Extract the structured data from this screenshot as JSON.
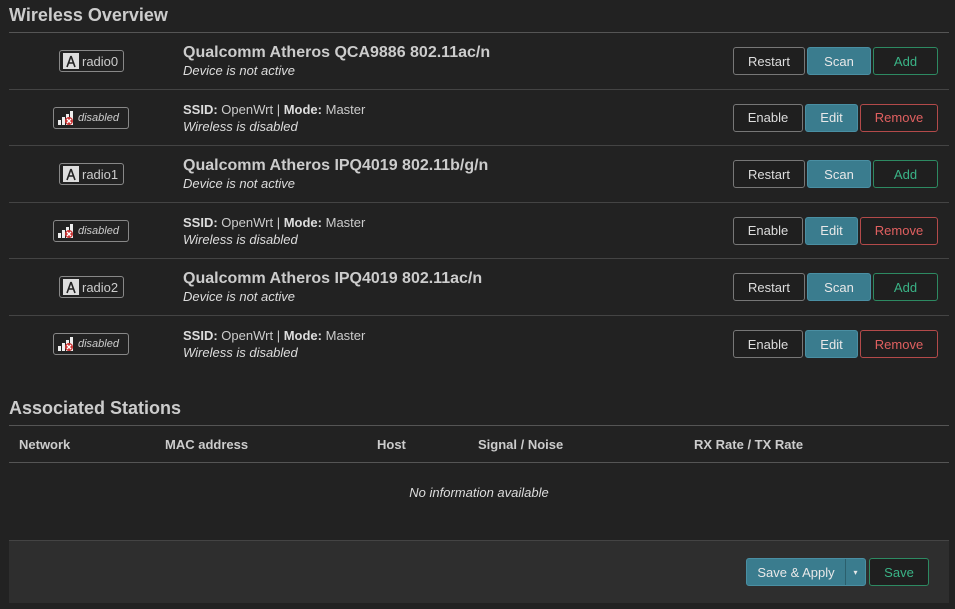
{
  "wireless": {
    "title": "Wireless Overview",
    "devices": [
      {
        "radio": {
          "badge": "radio0",
          "title": "Qualcomm Atheros QCA9886 802.11ac/n",
          "status": "Device is not active",
          "restart": "Restart",
          "scan": "Scan",
          "add": "Add"
        },
        "net": {
          "badge": "disabled",
          "ssid_label": "SSID:",
          "ssid": "OpenWrt",
          "sep": "|",
          "mode_label": "Mode:",
          "mode": "Master",
          "status": "Wireless is disabled",
          "enable": "Enable",
          "edit": "Edit",
          "remove": "Remove"
        }
      },
      {
        "radio": {
          "badge": "radio1",
          "title": "Qualcomm Atheros IPQ4019 802.11b/g/n",
          "status": "Device is not active",
          "restart": "Restart",
          "scan": "Scan",
          "add": "Add"
        },
        "net": {
          "badge": "disabled",
          "ssid_label": "SSID:",
          "ssid": "OpenWrt",
          "sep": "|",
          "mode_label": "Mode:",
          "mode": "Master",
          "status": "Wireless is disabled",
          "enable": "Enable",
          "edit": "Edit",
          "remove": "Remove"
        }
      },
      {
        "radio": {
          "badge": "radio2",
          "title": "Qualcomm Atheros IPQ4019 802.11ac/n",
          "status": "Device is not active",
          "restart": "Restart",
          "scan": "Scan",
          "add": "Add"
        },
        "net": {
          "badge": "disabled",
          "ssid_label": "SSID:",
          "ssid": "OpenWrt",
          "sep": "|",
          "mode_label": "Mode:",
          "mode": "Master",
          "status": "Wireless is disabled",
          "enable": "Enable",
          "edit": "Edit",
          "remove": "Remove"
        }
      }
    ]
  },
  "associated": {
    "title": "Associated Stations",
    "columns": [
      "Network",
      "MAC address",
      "Host",
      "Signal / Noise",
      "RX Rate / TX Rate"
    ],
    "empty": "No information available"
  },
  "footer": {
    "save_apply": "Save & Apply",
    "dropdown_glyph": "▾",
    "save": "Save"
  },
  "icons": {
    "radio_icon": "wifi-antenna-icon",
    "disabled_icon": "signal-disabled-icon"
  },
  "colors": {
    "background": "#222222",
    "primary": "#3a7c8e",
    "positive": "#3ab386",
    "negative": "#e06060"
  }
}
